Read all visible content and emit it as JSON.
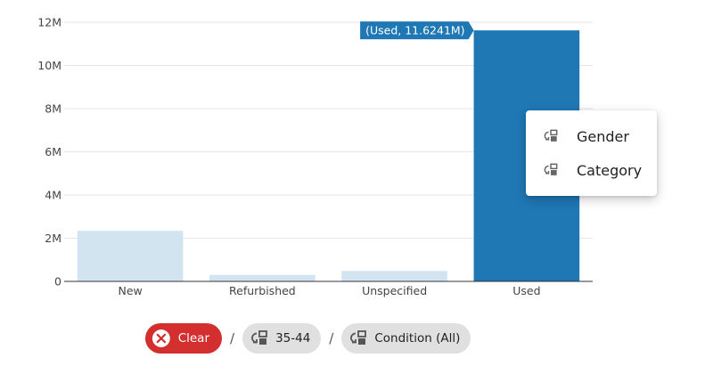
{
  "chart_data": {
    "type": "bar",
    "categories": [
      "New",
      "Refurbished",
      "Unspecified",
      "Used"
    ],
    "values": [
      2340000,
      300000,
      480000,
      11624100
    ],
    "ylim": [
      0,
      12000000
    ],
    "yticks": [
      "0",
      "2M",
      "4M",
      "6M",
      "8M",
      "10M",
      "12M"
    ],
    "ytick_values": [
      0,
      2000000,
      4000000,
      6000000,
      8000000,
      10000000,
      12000000
    ],
    "highlighted_index": 3,
    "grid": true,
    "colors": {
      "highlight": "#1f77b4",
      "faded": "#d2e4f0"
    }
  },
  "hover_label": "(Used, 11.6241M)",
  "context_menu": {
    "items": [
      {
        "label": "Gender",
        "icon": "drilldown-icon"
      },
      {
        "label": "Category",
        "icon": "drilldown-icon"
      }
    ]
  },
  "breadcrumbs": {
    "clear_label": "Clear",
    "separator": "/",
    "chips": [
      {
        "label": "35-44",
        "icon": "drilldown-icon"
      },
      {
        "label": "Condition (All)",
        "icon": "drilldown-icon"
      }
    ]
  },
  "colors": {
    "clear": "#d32f2f",
    "chip": "#e0e0e0"
  }
}
